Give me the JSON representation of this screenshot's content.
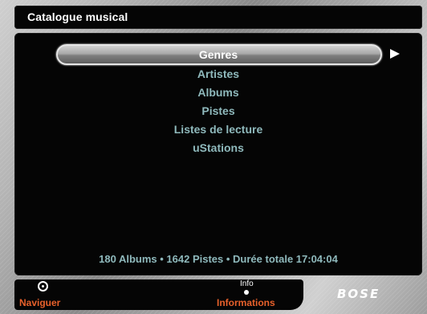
{
  "header": {
    "title": "Catalogue musical"
  },
  "menu": {
    "items": [
      {
        "label": "Genres",
        "selected": true
      },
      {
        "label": "Artistes",
        "selected": false
      },
      {
        "label": "Albums",
        "selected": false
      },
      {
        "label": "Pistes",
        "selected": false
      },
      {
        "label": "Listes de lecture",
        "selected": false
      },
      {
        "label": "uStations",
        "selected": false
      }
    ]
  },
  "stats": {
    "summary": "180 Albums • 1642 Pistes • Durée totale 17:04:04"
  },
  "footer": {
    "nav_label": "Naviguer",
    "info_small": "Info",
    "info_label": "Informations"
  },
  "brand": {
    "logo": "BOSE"
  },
  "colors": {
    "menu_text": "#8fb9bc",
    "footer_label": "#e8612b",
    "panel_bg": "#050505"
  },
  "icons": [
    "navigate-pad-icon",
    "info-dot-icon",
    "arrow-right-icon"
  ]
}
